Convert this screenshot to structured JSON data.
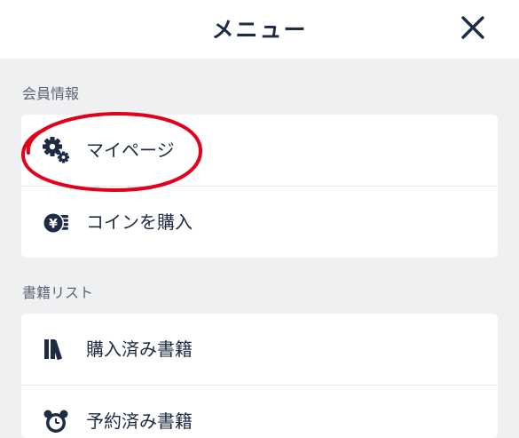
{
  "header": {
    "title": "メニュー"
  },
  "sections": [
    {
      "label": "会員情報",
      "items": [
        {
          "label": "マイページ",
          "icon": "gears-icon"
        },
        {
          "label": "コインを購入",
          "icon": "yen-coins-icon"
        }
      ]
    },
    {
      "label": "書籍リスト",
      "items": [
        {
          "label": "購入済み書籍",
          "icon": "books-icon"
        },
        {
          "label": "予約済み書籍",
          "icon": "alarm-clock-icon"
        }
      ]
    }
  ],
  "colors": {
    "text": "#1d2b45",
    "section_label": "#5b6475",
    "background": "#eff0f2",
    "highlight": "#e3001b"
  }
}
